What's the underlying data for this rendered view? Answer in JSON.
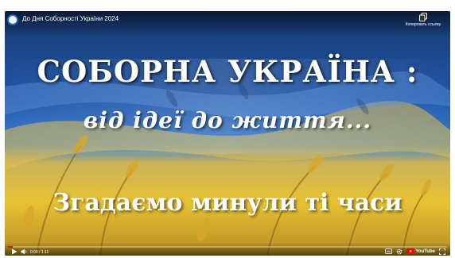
{
  "video": {
    "title": "До Дня Соборності України 2024",
    "copy_link_label": "Копировать ссылку",
    "headline": "СОБОРНА УКРАЇНА :",
    "subheadline": "від ідеї до життя...",
    "tagline": "Згадаємо минули ті часи"
  },
  "controls": {
    "time": "0:00 / 1:11",
    "progress_fraction": 0.01,
    "brand": "YouTube"
  },
  "colors": {
    "flag_blue": "#2156a8",
    "flag_yellow": "#e8c233",
    "progress": "#ff0000",
    "avatar_ring": "#1a66c8"
  },
  "icons": {
    "copy": "copy-icon",
    "play": "play-icon",
    "volume": "volume-icon",
    "settings": "gear-icon",
    "fullscreen": "fullscreen-icon",
    "subtitles": "subtitles-icon"
  }
}
